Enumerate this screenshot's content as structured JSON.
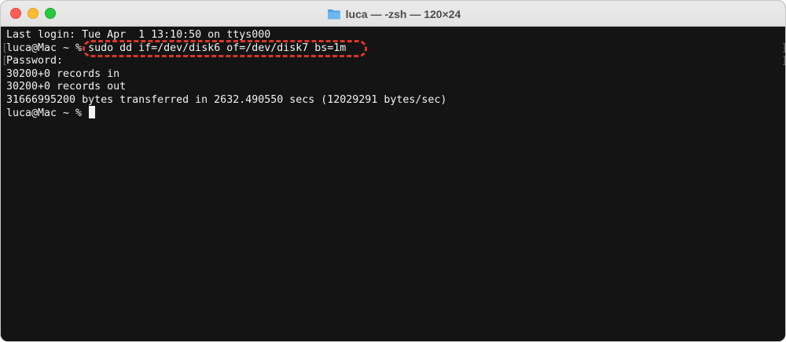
{
  "window": {
    "title": "luca — -zsh — 120×24"
  },
  "terminal": {
    "last_login": "Last login: Tue Apr  1 13:10:50 on ttys000",
    "prompt": "luca@Mac ~ %",
    "command": "sudo dd if=/dev/disk6 of=/dev/disk7 bs=1m",
    "password_prompt": "Password:",
    "records_in": "30200+0 records in",
    "records_out": "30200+0 records out",
    "transfer_summary": "31666995200 bytes transferred in 2632.490550 secs (12029291 bytes/sec)",
    "prompt_2": "luca@Mac ~ %"
  },
  "colors": {
    "background": "#141414",
    "text": "#f2f2f2",
    "annotation": "#d9362a"
  }
}
